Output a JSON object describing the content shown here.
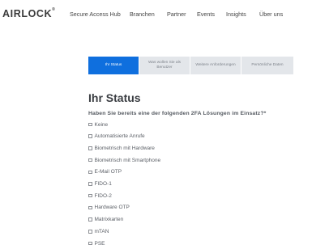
{
  "header": {
    "logo_text": "AIRLOCK",
    "logo_mark": "®",
    "nav": [
      "Secure Access Hub",
      "Branchen",
      "Partner",
      "Events",
      "Insights",
      "Über uns"
    ]
  },
  "steps": [
    {
      "label": "Ihr Status",
      "active": true
    },
    {
      "label": "Was wollen Sie als Benutzer",
      "active": false
    },
    {
      "label": "Weitere Anforderungen",
      "active": false
    },
    {
      "label": "Persönliche Daten",
      "active": false
    }
  ],
  "form": {
    "title": "Ihr Status",
    "question": "Haben Sie bereits eine der folgenden 2FA Lösungen im Einsatz?*",
    "options": [
      "Keine",
      "Automatisierte Anrufe",
      "Biometrisch mit Hardware",
      "Biometrisch mit Smartphone",
      "E-Mail OTP",
      "FIDO-1",
      "FIDO-2",
      "Hardware OTP",
      "Matrixkarten",
      "mTAN",
      "PSE"
    ]
  },
  "colors": {
    "accent": "#0f6fde",
    "step_inactive": "#e3e6ea"
  }
}
